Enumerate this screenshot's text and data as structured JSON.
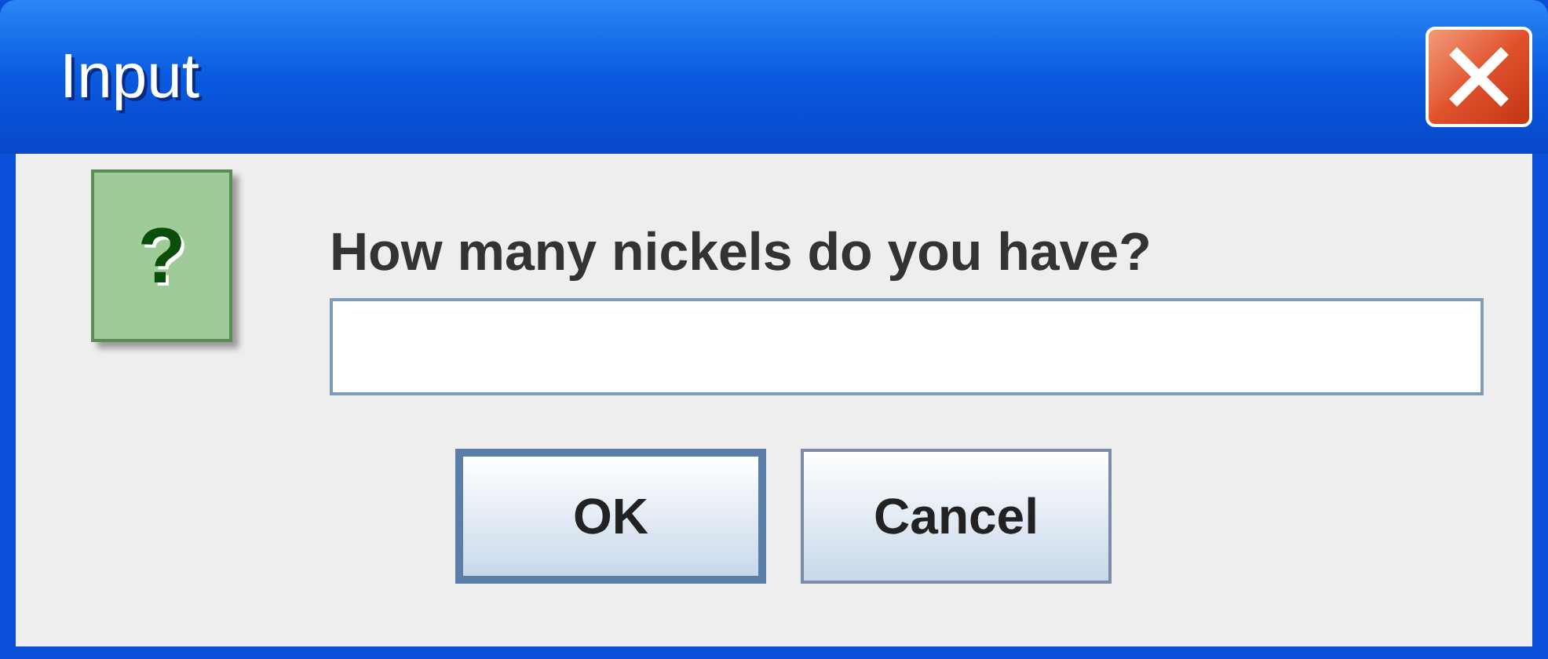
{
  "window": {
    "title": "Input"
  },
  "dialog": {
    "icon_glyph": "?",
    "message": "How many nickels do you have?",
    "buttons": [
      {
        "label": "OK",
        "selected": true
      },
      {
        "label": "Cancel",
        "selected": false
      }
    ]
  }
}
